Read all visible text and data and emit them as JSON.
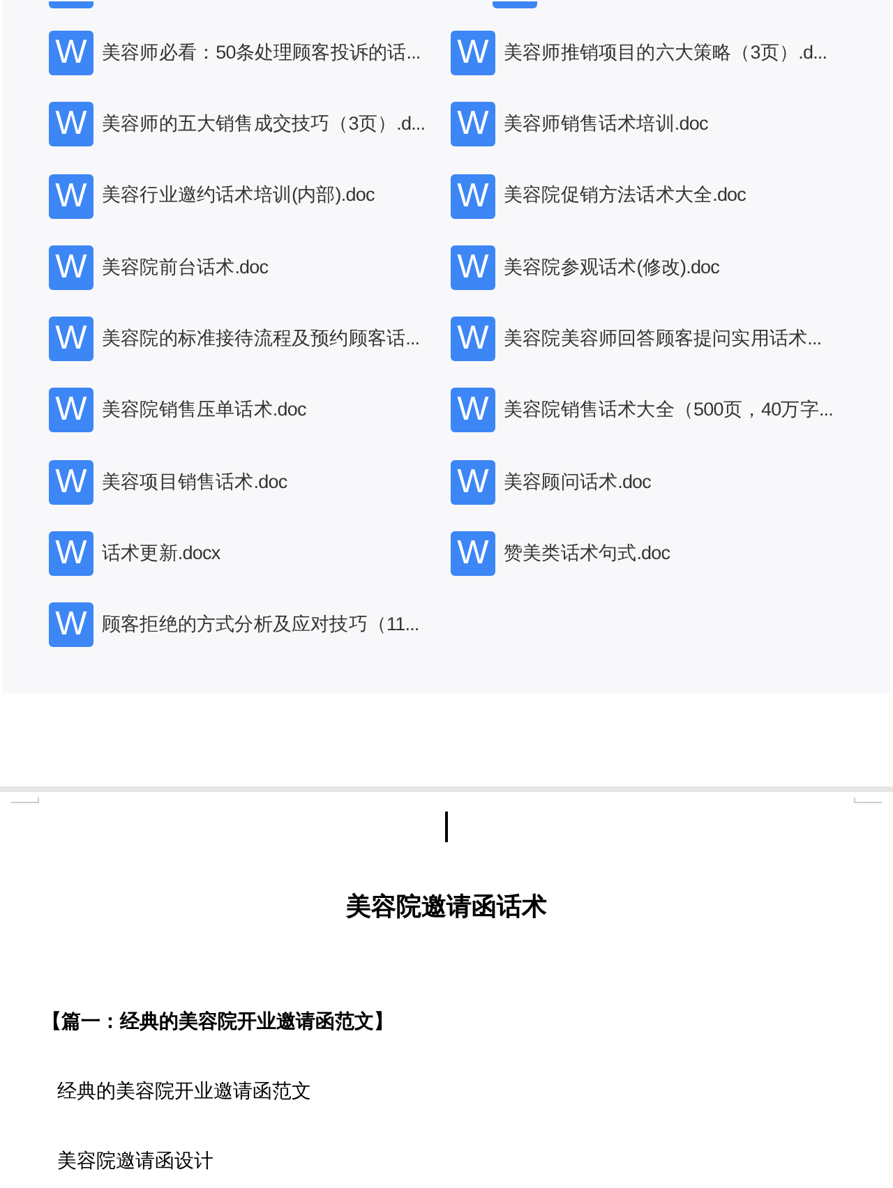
{
  "files": [
    {
      "icon": "W",
      "name": "美容师必看：50条处理顾客投诉的话..."
    },
    {
      "icon": "W",
      "name": "美容师推销项目的六大策略（3页）.d..."
    },
    {
      "icon": "W",
      "name": "美容师的五大销售成交技巧（3页）.d..."
    },
    {
      "icon": "W",
      "name": "美容师销售话术培训.doc"
    },
    {
      "icon": "W",
      "name": "美容行业邀约话术培训(内部).doc"
    },
    {
      "icon": "W",
      "name": "美容院促销方法话术大全.doc"
    },
    {
      "icon": "W",
      "name": "美容院前台话术.doc"
    },
    {
      "icon": "W",
      "name": "美容院参观话术(修改).doc"
    },
    {
      "icon": "W",
      "name": "美容院的标准接待流程及预约顾客话..."
    },
    {
      "icon": "W",
      "name": "美容院美容师回答顾客提问实用话术..."
    },
    {
      "icon": "W",
      "name": "美容院销售压单话术.doc"
    },
    {
      "icon": "W",
      "name": "美容院销售话术大全（500页，40万字..."
    },
    {
      "icon": "W",
      "name": "美容项目销售话术.doc"
    },
    {
      "icon": "W",
      "name": "美容顾问话术.doc"
    },
    {
      "icon": "W",
      "name": "话术更新.docx"
    },
    {
      "icon": "W",
      "name": "赞美类话术句式.doc"
    },
    {
      "icon": "W",
      "name": "顾客拒绝的方式分析及应对技巧（11..."
    }
  ],
  "document": {
    "title": "美容院邀请函话术",
    "heading": "【篇一：经典的美容院开业邀请函范文】",
    "paragraphs": [
      "经典的美容院开业邀请函范文",
      "美容院邀请函设计"
    ]
  }
}
